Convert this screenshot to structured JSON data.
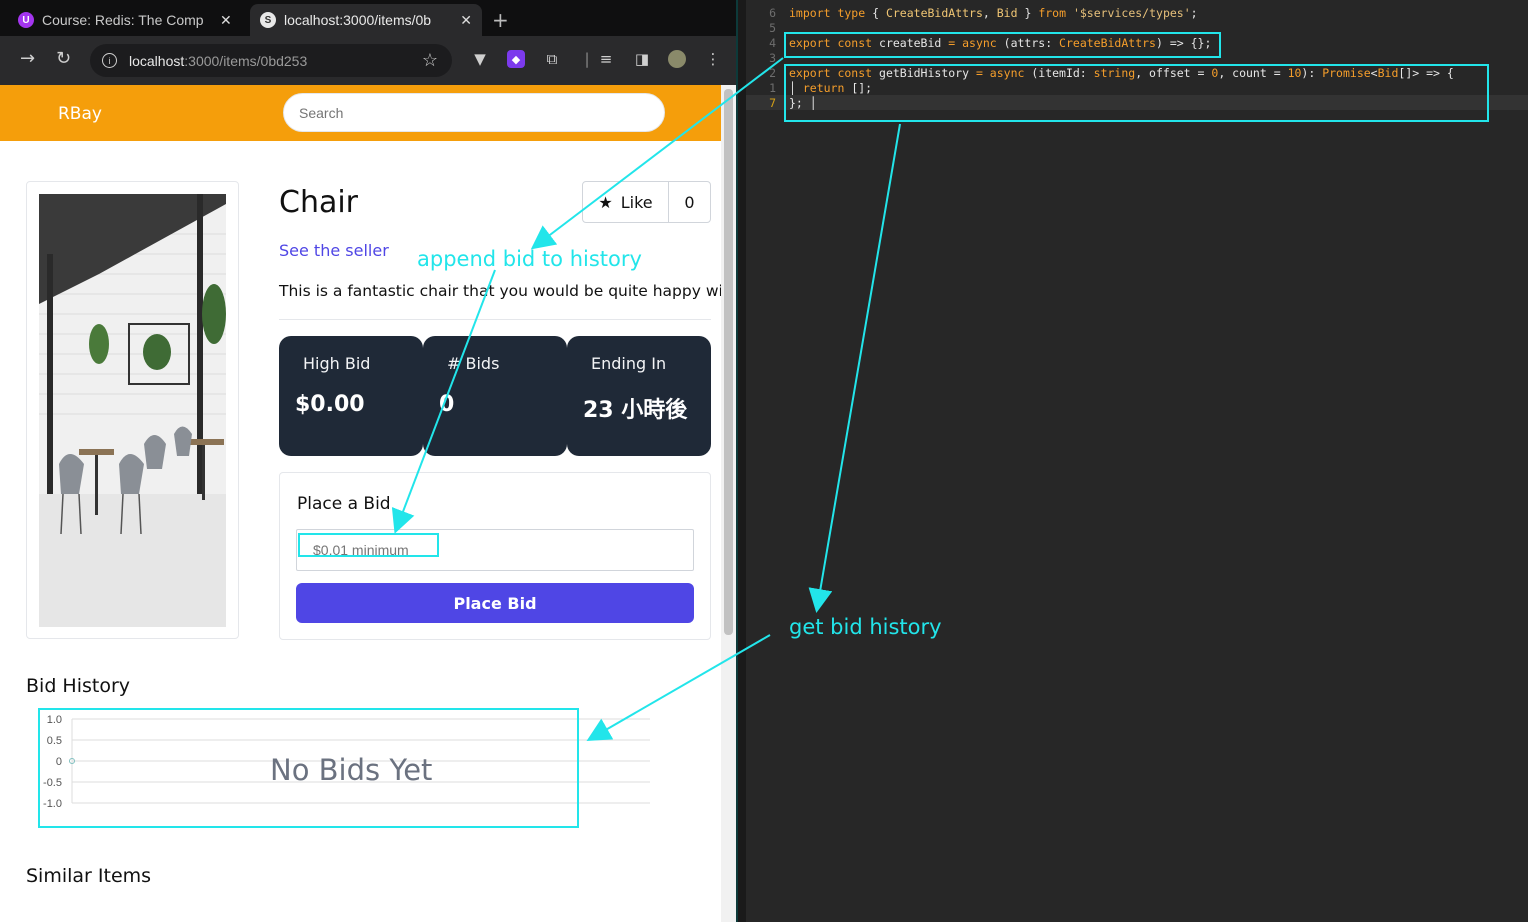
{
  "browser": {
    "tabs": [
      {
        "title": "Course: Redis: The Comp",
        "favicon": "udemy-icon",
        "active": false
      },
      {
        "title": "localhost:3000/items/0b",
        "favicon": "svelte-icon",
        "active": true
      }
    ],
    "url_host": "localhost",
    "url_path": ":3000/items/0bd253"
  },
  "page": {
    "brand": "RBay",
    "search_placeholder": "Search",
    "item": {
      "name": "Chair",
      "like_label": "Like",
      "like_count": "0",
      "seller_link": "See the seller",
      "description": "This is a fantastic chair that you would be quite happy with!"
    },
    "stats": [
      {
        "label": "High Bid",
        "value": "$0.00"
      },
      {
        "label": "# Bids",
        "value": "0"
      },
      {
        "label": "Ending In",
        "value": "23 小時後"
      }
    ],
    "bid": {
      "title": "Place a Bid",
      "placeholder": "$0.01 minimum",
      "button": "Place Bid"
    },
    "history_title": "Bid History",
    "no_bids": "No Bids Yet",
    "similar_title": "Similar Items"
  },
  "chart_data": {
    "type": "line",
    "title": "",
    "yticks": [
      "1.0",
      "0.5",
      "0",
      "-0.5",
      "-1.0"
    ],
    "ylim": [
      -1.0,
      1.0
    ],
    "series": [
      {
        "values": [
          0
        ]
      }
    ],
    "grid": true
  },
  "editor": {
    "lines": [
      {
        "num": "6",
        "parts": [
          [
            "kw",
            "import type "
          ],
          [
            "pl",
            "{ "
          ],
          [
            "cls",
            "CreateBidAttrs"
          ],
          [
            "pl",
            ", "
          ],
          [
            "cls",
            "Bid"
          ],
          [
            "pl",
            " } "
          ],
          [
            "kw",
            "from "
          ],
          [
            "st",
            "'$services/types'"
          ],
          [
            "pl",
            ";"
          ]
        ]
      },
      {
        "num": "5",
        "parts": []
      },
      {
        "num": "4",
        "parts": [
          [
            "kw",
            "export const "
          ],
          [
            "pl",
            "createBid "
          ],
          [
            "kw",
            "= async "
          ],
          [
            "pl",
            "(attrs: "
          ],
          [
            "ty",
            "CreateBidAttrs"
          ],
          [
            "pl",
            ") => {};"
          ]
        ]
      },
      {
        "num": "3",
        "parts": []
      },
      {
        "num": "2",
        "parts": [
          [
            "kw",
            "export const "
          ],
          [
            "pl",
            "getBidHistory "
          ],
          [
            "kw",
            "= async "
          ],
          [
            "pl",
            "(itemId: "
          ],
          [
            "ty",
            "string"
          ],
          [
            "pl",
            ", offset = "
          ],
          [
            "kw",
            "0"
          ],
          [
            "pl",
            ", count = "
          ],
          [
            "kw",
            "10"
          ],
          [
            "pl",
            "): "
          ],
          [
            "ty",
            "Promise"
          ],
          [
            "pl",
            "<"
          ],
          [
            "ty",
            "Bid"
          ],
          [
            "pl",
            "[]> => {"
          ]
        ]
      },
      {
        "num": "1",
        "parts": [
          [
            "pl",
            "│ "
          ],
          [
            "kw",
            "return "
          ],
          [
            "pl",
            "[];"
          ]
        ]
      },
      {
        "num": "7",
        "parts": [
          [
            "pl",
            "}; │"
          ]
        ]
      }
    ]
  },
  "annotations": {
    "append": "append bid to history",
    "get": "get bid history"
  },
  "colors": {
    "header": "#f59e0b",
    "accent": "#4f46e5",
    "stat_bg": "#1f2937",
    "annotation": "#22e5ea"
  }
}
